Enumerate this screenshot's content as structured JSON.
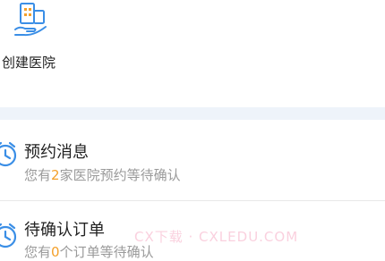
{
  "top": {
    "create_hospital": {
      "label": "创建医院",
      "icon": "hospital-hand-icon"
    }
  },
  "messages": [
    {
      "title": "预约消息",
      "sub_prefix": "您有",
      "count": "2",
      "sub_suffix": "家医院预约等待确认",
      "icon": "alarm-clock-icon"
    },
    {
      "title": "待确认订单",
      "sub_prefix": "您有",
      "count": "0",
      "sub_suffix": "个订单等待确认",
      "icon": "alarm-clock-icon"
    }
  ],
  "watermark": "CX下载 · CXLEDU.COM",
  "colors": {
    "accent": "#3a8ee6",
    "count": "#f4a02a",
    "band": "#eef3fa"
  }
}
